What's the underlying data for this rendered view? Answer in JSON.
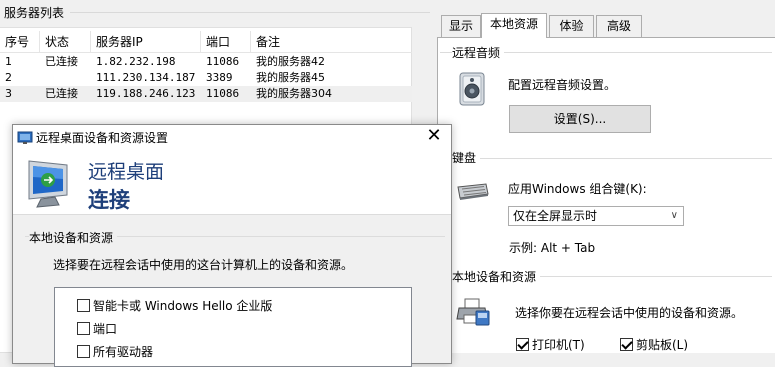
{
  "server_list": {
    "title": "服务器列表",
    "columns": [
      "序号",
      "状态",
      "服务器IP",
      "端口",
      "备注"
    ],
    "rows": [
      {
        "index": "1",
        "status": "已连接",
        "ip": "1.82.232.198",
        "port": "11086",
        "note": "我的服务器42"
      },
      {
        "index": "2",
        "status": "",
        "ip": "111.230.134.187",
        "port": "3389",
        "note": "我的服务器45"
      },
      {
        "index": "3",
        "status": "已连接",
        "ip": "119.188.246.123",
        "port": "11086",
        "note": "我的服务器304"
      }
    ],
    "selected_row": 3
  },
  "props": {
    "tabs": [
      "显示",
      "本地资源",
      "体验",
      "高级"
    ],
    "active_tab": "本地资源",
    "audio": {
      "group_label": "远程音频",
      "description": "配置远程音频设置。",
      "button_label": "设置(S)..."
    },
    "keyboard": {
      "group_label": "键盘",
      "description": "应用Windows 组合键(K):",
      "selected_option": "仅在全屏显示时",
      "example": "示例: Alt + Tab"
    },
    "local_devices": {
      "group_label": "本地设备和资源",
      "description": "选择你要在远程会话中使用的设备和资源。",
      "printer_label": "打印机(T)",
      "printer_checked": true,
      "clipboard_label": "剪贴板(L)",
      "clipboard_checked": true
    }
  },
  "dialog": {
    "title": "远程桌面设备和资源设置",
    "close_glyph": "✕",
    "banner_line1": "远程桌面",
    "banner_line2": "连接",
    "group_label": "本地设备和资源",
    "description": "选择要在远程会话中使用的这台计算机上的设备和资源。",
    "items": [
      {
        "label": "智能卡或 Windows Hello 企业版",
        "checked": false
      },
      {
        "label": "端口",
        "checked": false
      },
      {
        "label": "所有驱动器",
        "checked": false
      }
    ]
  },
  "icons": {
    "speaker": "speaker-icon",
    "keyboard": "keyboard-icon",
    "printer": "printer-icon",
    "rdp_logo": "remote-desktop-icon"
  }
}
